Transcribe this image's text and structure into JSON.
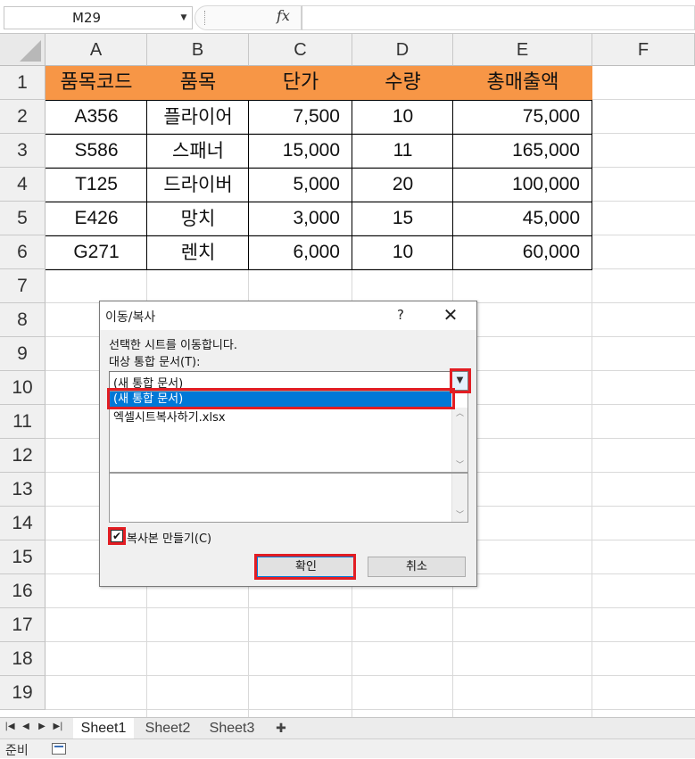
{
  "formula_bar": {
    "name_box": "M29",
    "fx_label": "fx",
    "formula": ""
  },
  "columns": [
    "A",
    "B",
    "C",
    "D",
    "E",
    "F"
  ],
  "rows": [
    "1",
    "2",
    "3",
    "4",
    "5",
    "6",
    "7",
    "8",
    "9",
    "10",
    "11",
    "12",
    "13",
    "14",
    "15",
    "16",
    "17",
    "18",
    "19"
  ],
  "table": {
    "header": [
      "품목코드",
      "품목",
      "단가",
      "수량",
      "총매출액"
    ],
    "header_color": "#f79646",
    "rows": [
      [
        "A356",
        "플라이어",
        "7,500",
        "10",
        "75,000"
      ],
      [
        "S586",
        "스패너",
        "15,000",
        "11",
        "165,000"
      ],
      [
        "T125",
        "드라이버",
        "5,000",
        "20",
        "100,000"
      ],
      [
        "E426",
        "망치",
        "3,000",
        "15",
        "45,000"
      ],
      [
        "G271",
        "렌치",
        "6,000",
        "10",
        "60,000"
      ]
    ]
  },
  "sheet_tabs": [
    "Sheet1",
    "Sheet2",
    "Sheet3"
  ],
  "status": {
    "text": "준비"
  },
  "dialog": {
    "title": "이동/복사",
    "help": "?",
    "close": "✕",
    "instruction": "선택한 시트를 이동합니다.",
    "target_label": "대상 통합 문서(T):",
    "dropdown_value": "(새 통합 문서)",
    "list_items": [
      "(새 통합 문서)",
      "엑셀시트복사하기.xlsx"
    ],
    "copy_checkbox_label": "복사본 만들기(C)",
    "copy_checked": true,
    "ok_label": "확인",
    "cancel_label": "취소",
    "highlight_color": "#e21d23"
  }
}
